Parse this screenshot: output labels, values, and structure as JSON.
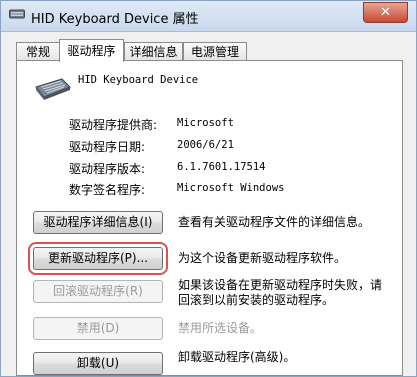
{
  "window": {
    "title": "HID Keyboard Device 属性",
    "close_label": "✕"
  },
  "tabs": [
    {
      "label": "常规"
    },
    {
      "label": "驱动程序"
    },
    {
      "label": "详细信息"
    },
    {
      "label": "电源管理"
    }
  ],
  "device": {
    "name": "HID Keyboard Device"
  },
  "info": [
    {
      "label": "驱动程序提供商:",
      "value": "Microsoft"
    },
    {
      "label": "驱动程序日期:",
      "value": "2006/6/21"
    },
    {
      "label": "驱动程序版本:",
      "value": "6.1.7601.17514"
    },
    {
      "label": "数字签名程序:",
      "value": "Microsoft Windows"
    }
  ],
  "actions": [
    {
      "button": "驱动程序详细信息(I)",
      "desc": "查看有关驱动程序文件的详细信息。"
    },
    {
      "button": "更新驱动程序(P)...",
      "desc": "为这个设备更新驱动程序软件。"
    },
    {
      "button": "回滚驱动程序(R)",
      "desc_line1": "如果该设备在更新驱动程序时失败，请",
      "desc_line2": "回滚到以前安装的驱动程序。"
    },
    {
      "button": "禁用(D)",
      "desc": "禁用所选设备。"
    },
    {
      "button": "卸载(U)",
      "desc": "卸载驱动程序(高级)。"
    }
  ]
}
